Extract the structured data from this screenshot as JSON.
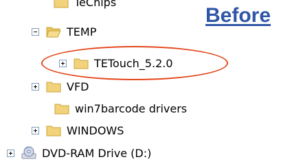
{
  "header": {
    "label": "Before"
  },
  "tree": {
    "items": [
      {
        "label": "TeChips",
        "expander": "none",
        "icon": "folder-icon"
      },
      {
        "label": "TEMP",
        "expander": "minus",
        "icon": "folder-open-icon"
      },
      {
        "label": "TETouch_5.2.0",
        "expander": "plus",
        "icon": "folder-icon"
      },
      {
        "label": "VFD",
        "expander": "plus",
        "icon": "folder-icon"
      },
      {
        "label": "win7barcode drivers",
        "expander": "none",
        "icon": "folder-icon"
      },
      {
        "label": "WINDOWS",
        "expander": "plus",
        "icon": "folder-icon"
      },
      {
        "label": "DVD-RAM Drive (D:)",
        "expander": "plus",
        "icon": "dvd-drive-icon"
      }
    ]
  },
  "colors": {
    "before": "#2f56a6",
    "highlight_ellipse": "#e4451a",
    "folder": "#f2d27a",
    "folder_edge": "#c9a33a"
  }
}
